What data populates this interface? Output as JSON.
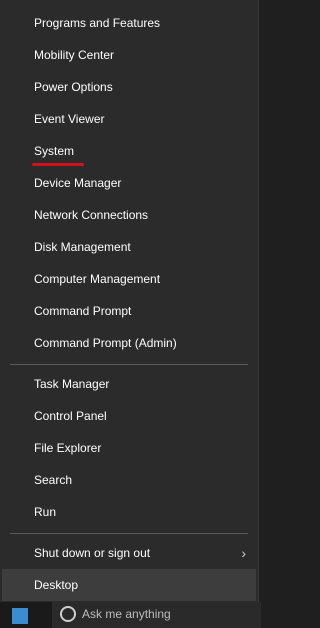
{
  "menu": {
    "group1": [
      {
        "label": "Programs and Features"
      },
      {
        "label": "Mobility Center"
      },
      {
        "label": "Power Options"
      },
      {
        "label": "Event Viewer"
      },
      {
        "label": "System"
      },
      {
        "label": "Device Manager"
      },
      {
        "label": "Network Connections"
      },
      {
        "label": "Disk Management"
      },
      {
        "label": "Computer Management"
      },
      {
        "label": "Command Prompt"
      },
      {
        "label": "Command Prompt (Admin)"
      }
    ],
    "group2": [
      {
        "label": "Task Manager"
      },
      {
        "label": "Control Panel"
      },
      {
        "label": "File Explorer"
      },
      {
        "label": "Search"
      },
      {
        "label": "Run"
      }
    ],
    "group3": [
      {
        "label": "Shut down or sign out"
      },
      {
        "label": "Desktop"
      }
    ],
    "submenu_glyph": "›"
  },
  "taskbar": {
    "search_text": "Ask me anything"
  },
  "colors": {
    "menu_bg": "#2b2b2b",
    "highlight": "#3d3d3d",
    "annotation_underline": "#d0131a",
    "text": "#ffffff"
  }
}
